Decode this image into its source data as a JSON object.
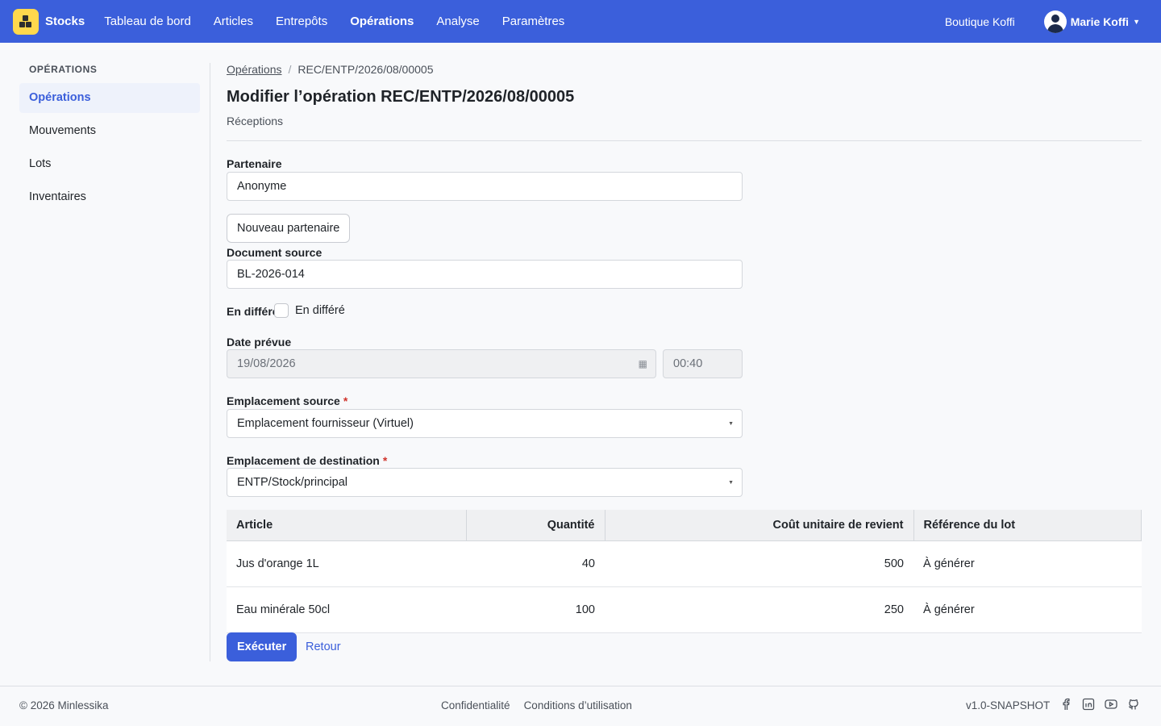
{
  "nav": {
    "brand": "Stocks",
    "items": [
      "Tableau de bord",
      "Articles",
      "Entrepôts",
      "Opérations",
      "Analyse",
      "Paramètres"
    ],
    "active_index": 3,
    "shop": "Boutique Koffi",
    "user": "Marie Koffi"
  },
  "sidebar": {
    "title": "OPÉRATIONS",
    "items": [
      "Opérations",
      "Mouvements",
      "Lots",
      "Inventaires"
    ],
    "active_index": 0
  },
  "breadcrumb": {
    "parent": "Opérations",
    "current": "REC/ENTP/2026/08/00005"
  },
  "page": {
    "title": "Modifier l’opération REC/ENTP/2026/08/00005",
    "subtitle": "Réceptions"
  },
  "form": {
    "partner_label": "Partenaire",
    "partner_value": "Anonyme",
    "new_partner_label": "Nouveau partenaire",
    "source_doc_label": "Document source",
    "source_doc_value": "BL-2026-014",
    "deferred_label": "En différé",
    "deferred_checkbox_label": "En différé",
    "deferred_checked": false,
    "date_label": "Date prévue",
    "date_value": "19/08/2026",
    "time_value": "00:40",
    "source_loc_label": "Emplacement source",
    "source_loc_value": "Emplacement fournisseur (Virtuel)",
    "dest_loc_label": "Emplacement de destination",
    "dest_loc_value": "ENTP/Stock/principal",
    "required_mark": "*"
  },
  "table": {
    "headers": [
      "Article",
      "Quantité",
      "Coût unitaire de revient",
      "Référence du lot"
    ],
    "rows": [
      [
        "Jus d'orange 1L",
        "40",
        "500",
        "À générer"
      ],
      [
        "Eau minérale 50cl",
        "100",
        "250",
        "À générer"
      ]
    ]
  },
  "actions": {
    "execute": "Exécuter",
    "back": "Retour"
  },
  "footer": {
    "copyright": "© 2026 Minlessika",
    "links": [
      "Confidentialité",
      "Conditions d’utilisation"
    ],
    "version": "v1.0-SNAPSHOT",
    "social": [
      "facebook-icon",
      "linkedin-icon",
      "youtube-icon",
      "github-icon"
    ]
  },
  "colors": {
    "primary": "#3b5fdb",
    "logo": "#ffd84d",
    "required": "#d0342c"
  }
}
